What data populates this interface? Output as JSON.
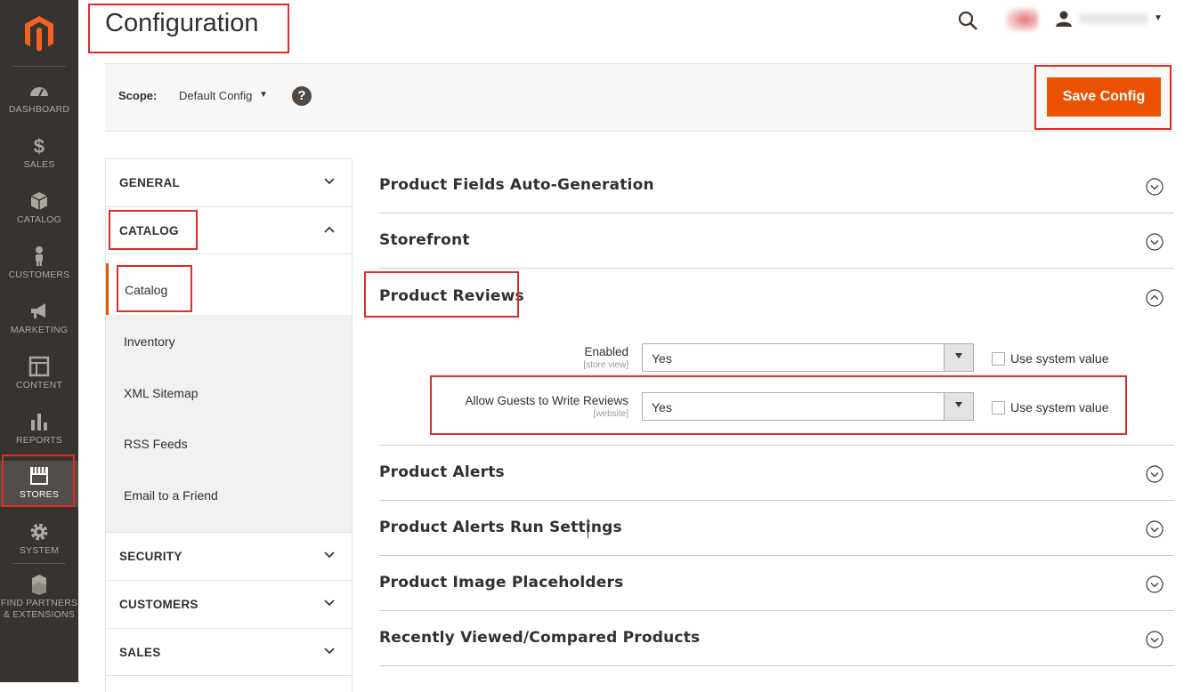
{
  "sidebar": {
    "items": [
      {
        "label": "DASHBOARD",
        "icon": "dashboard-icon"
      },
      {
        "label": "SALES",
        "icon": "dollar-icon"
      },
      {
        "label": "CATALOG",
        "icon": "cube-icon"
      },
      {
        "label": "CUSTOMERS",
        "icon": "person-icon"
      },
      {
        "label": "MARKETING",
        "icon": "megaphone-icon"
      },
      {
        "label": "CONTENT",
        "icon": "layout-icon"
      },
      {
        "label": "REPORTS",
        "icon": "bar-chart-icon"
      },
      {
        "label": "STORES",
        "icon": "storefront-icon",
        "active": true
      },
      {
        "label": "SYSTEM",
        "icon": "gear-icon"
      },
      {
        "label1": "FIND PARTNERS",
        "label2": "& EXTENSIONS",
        "icon": "boxes-icon"
      }
    ]
  },
  "header": {
    "title": "Configuration"
  },
  "scope": {
    "label": "Scope:",
    "value": "Default Config",
    "save_label": "Save Config"
  },
  "tabs": {
    "general": "GENERAL",
    "catalog": "CATALOG",
    "catalog_items": [
      "Catalog",
      "Inventory",
      "XML Sitemap",
      "RSS Feeds",
      "Email to a Friend"
    ],
    "security": "SECURITY",
    "customers": "CUSTOMERS",
    "sales": "SALES"
  },
  "sections": {
    "s1": "Product Fields Auto-Generation",
    "s2": "Storefront",
    "s3": "Product Reviews",
    "s4": "Product Alerts",
    "s5": "Product Alerts Run Settings",
    "s6": "Product Image Placeholders",
    "s7": "Recently Viewed/Compared Products"
  },
  "reviews": {
    "enabled_label": "Enabled",
    "enabled_scope": "[store view]",
    "enabled_value": "Yes",
    "guests_label": "Allow Guests to Write Reviews",
    "guests_scope": "[website]",
    "guests_value": "Yes",
    "use_system": "Use system value"
  },
  "colors": {
    "accent": "#eb5202",
    "sidebar_bg": "#373330",
    "highlight_red": "#e02b27"
  }
}
